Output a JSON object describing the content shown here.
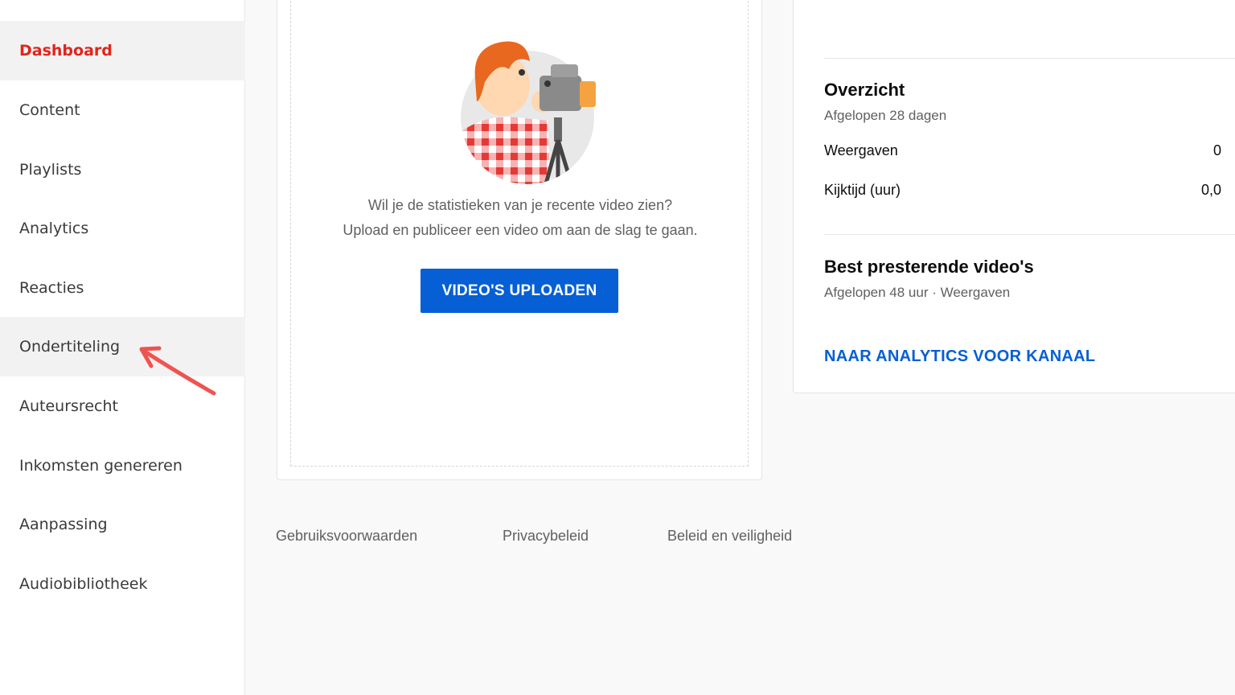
{
  "sidebar": {
    "items": [
      {
        "label": "Dashboard",
        "icon": "dashboard-icon"
      },
      {
        "label": "Content",
        "icon": "content-icon"
      },
      {
        "label": "Playlists",
        "icon": "playlists-icon"
      },
      {
        "label": "Analytics",
        "icon": "analytics-icon"
      },
      {
        "label": "Reacties",
        "icon": "comments-icon"
      },
      {
        "label": "Ondertiteling",
        "icon": "subtitles-icon"
      },
      {
        "label": "Auteursrecht",
        "icon": "copyright-icon"
      },
      {
        "label": "Inkomsten genereren",
        "icon": "monetization-icon"
      },
      {
        "label": "Aanpassing",
        "icon": "customization-icon"
      },
      {
        "label": "Audiobibliotheek",
        "icon": "audio-library-icon"
      }
    ],
    "active_index": 0
  },
  "upload": {
    "line1": "Wil je de statistieken van je recente video zien?",
    "line2": "Upload en publiceer een video om aan de slag te gaan.",
    "button_label": "VIDEO'S UPLOADEN"
  },
  "analytics": {
    "overview_title": "Overzicht",
    "overview_period": "Afgelopen 28 dagen",
    "metrics": [
      {
        "label": "Weergaven",
        "value": "0"
      },
      {
        "label": "Kijktijd (uur)",
        "value": "0,0"
      }
    ],
    "top_videos_title": "Best presterende video's",
    "top_videos_sub": "Afgelopen 48 uur · Weergaven",
    "link_label": "NAAR ANALYTICS VOOR KANAAL"
  },
  "footer": {
    "links": [
      "Gebruiksvoorwaarden",
      "Privacybeleid",
      "Beleid en veiligheid"
    ]
  },
  "colors": {
    "accent_red": "#e3241b",
    "primary_blue": "#065fd4",
    "annotation_arrow": "#ef5350"
  }
}
